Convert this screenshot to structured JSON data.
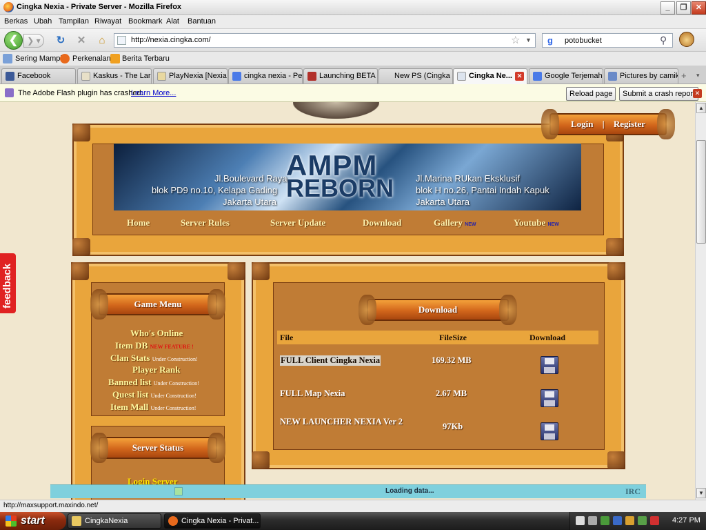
{
  "window": {
    "title": "Cingka Nexia - Private Server - Mozilla Firefox"
  },
  "menu": [
    "Berkas",
    "Ubah",
    "Tampilan",
    "Riwayat",
    "Bookmark",
    "Alat",
    "Bantuan"
  ],
  "nav": {
    "url": "http://nexia.cingka.com/",
    "search": "potobucket"
  },
  "bookmarks": [
    "Sering Mampir",
    "Perkenalan",
    "Berita Terbaru"
  ],
  "tabs": [
    {
      "label": "Facebook",
      "color": "#3b5998"
    },
    {
      "label": "Kaskus - The Lar...",
      "color": "#e8e0c8"
    },
    {
      "label": "PlayNexia [Nexia ...",
      "color": "#e8d8a0"
    },
    {
      "label": "cingka nexia - Pe...",
      "color": "#4a7ae8"
    },
    {
      "label": "Launching BETA ...",
      "color": "#b2302a"
    },
    {
      "label": "New PS (Cingka ...",
      "color": "#eeeeee"
    },
    {
      "label": "Cingka Ne...",
      "color": "#dde4ee"
    },
    {
      "label": "Google Terjemah...",
      "color": "#4a7ae8"
    },
    {
      "label": "Pictures by camik...",
      "color": "#6a8ac8"
    }
  ],
  "notification": {
    "message": "The Adobe Flash plugin has crashed.",
    "learn_more": "Learn More...",
    "reload": "Reload page",
    "submit": "Submit a crash report"
  },
  "site": {
    "login": "Login",
    "separator": "|",
    "register": "Register",
    "banner": {
      "logo_top": "AMPM",
      "logo_bottom": "REBORN",
      "left_addr": [
        "Jl.Boulevard Raya",
        "blok PD9 no.10, Kelapa Gading",
        "Jakarta Utara"
      ],
      "right_addr": [
        "Jl.Marina RUkan Eksklusif",
        "blok H no.26, Pantai Indah Kapuk",
        "Jakarta Utara"
      ]
    },
    "nav_links": [
      {
        "label": "Home",
        "badge": ""
      },
      {
        "label": "Server Rules",
        "badge": ""
      },
      {
        "label": "Server Update",
        "badge": ""
      },
      {
        "label": "Download",
        "badge": ""
      },
      {
        "label": "Gallery",
        "badge": "NEW"
      },
      {
        "label": "Youtube",
        "badge": "NEW"
      }
    ],
    "game_menu": {
      "title": "Game Menu",
      "items": [
        {
          "label": "Who's Online",
          "note": "",
          "note_type": ""
        },
        {
          "label": "Item DB",
          "note": "NEW FEATURE !",
          "note_type": "new"
        },
        {
          "label": "Clan Stats",
          "note": "Under Construction!",
          "note_type": "uc"
        },
        {
          "label": "Player Rank",
          "note": "",
          "note_type": ""
        },
        {
          "label": "Banned list",
          "note": "Under Construction!",
          "note_type": "uc"
        },
        {
          "label": "Quest list",
          "note": "Under Construction!",
          "note_type": "uc"
        },
        {
          "label": "Item Mall",
          "note": "Under Construction!",
          "note_type": "uc"
        }
      ]
    },
    "server_status": {
      "title": "Server Status",
      "login_server": "Login Server"
    },
    "download": {
      "title": "Download",
      "headers": [
        "File",
        "FileSize",
        "Download"
      ],
      "rows": [
        {
          "file": "FULL Client Cingka Nexia",
          "size": "169.32 MB"
        },
        {
          "file": "FULL Map Nexia",
          "size": "2.67 MB"
        },
        {
          "file": "NEW LAUNCHER NEXIA Ver 2",
          "size": "97Kb"
        }
      ]
    },
    "feedback": "feedback",
    "loading": "Loading data...",
    "irc": "IRC"
  },
  "status": {
    "text": "http://maxsupport.maxindo.net/"
  },
  "taskbar": {
    "start": "start",
    "tasks": [
      "CingkaNexia",
      "Cingka Nexia - Privat..."
    ],
    "clock": "4:27 PM"
  },
  "colors": {
    "accent": "#e9a53c",
    "banner": "#1b3c66",
    "link": "#fff8a0"
  }
}
